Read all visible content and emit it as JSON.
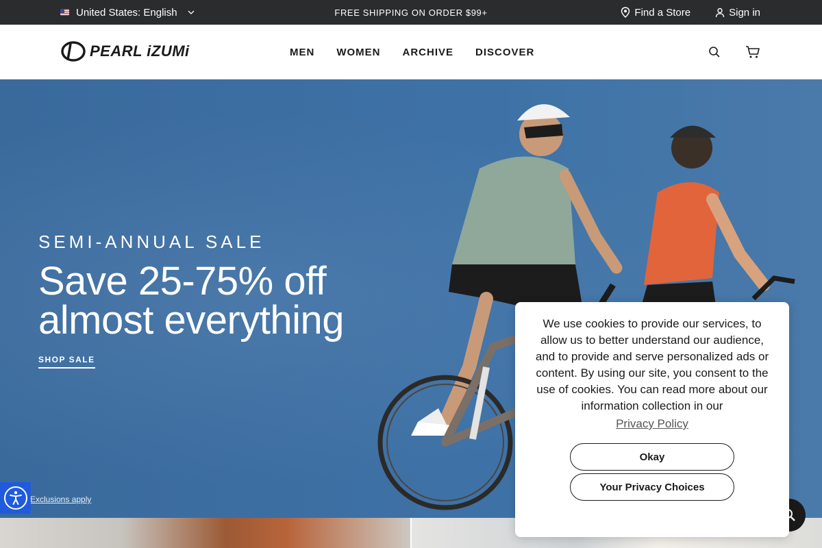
{
  "topbar": {
    "locale_label": "United States: English",
    "promo": "FREE SHIPPING ON ORDER $99+",
    "find_store": "Find a Store",
    "sign_in": "Sign in"
  },
  "header": {
    "brand": "PEARL iZUMi",
    "nav": [
      "MEN",
      "WOMEN",
      "ARCHIVE",
      "DISCOVER"
    ],
    "icons": [
      "search-icon",
      "cart-icon"
    ]
  },
  "hero": {
    "eyebrow": "SEMI-ANNUAL SALE",
    "headline_line1": "Save 25-75% off",
    "headline_line2": "almost everything",
    "cta": "SHOP SALE",
    "exclusions": "Exclusions apply"
  },
  "cookie_banner": {
    "message": "We use cookies to provide our services, to allow us to better understand our audience, and to provide and serve personalized ads or content. By using our site, you consent to the use of cookies. You can read more about our information collection in our",
    "policy_link": "Privacy Policy",
    "okay_button": "Okay",
    "choices_button": "Your Privacy Choices"
  },
  "colors": {
    "topbar_bg": "#2a2c2e",
    "hero_sky": "#3d6fa3",
    "a11y_blue": "#1f5bdc",
    "jersey_green": "#8fa89a",
    "jersey_orange": "#e2643a"
  }
}
